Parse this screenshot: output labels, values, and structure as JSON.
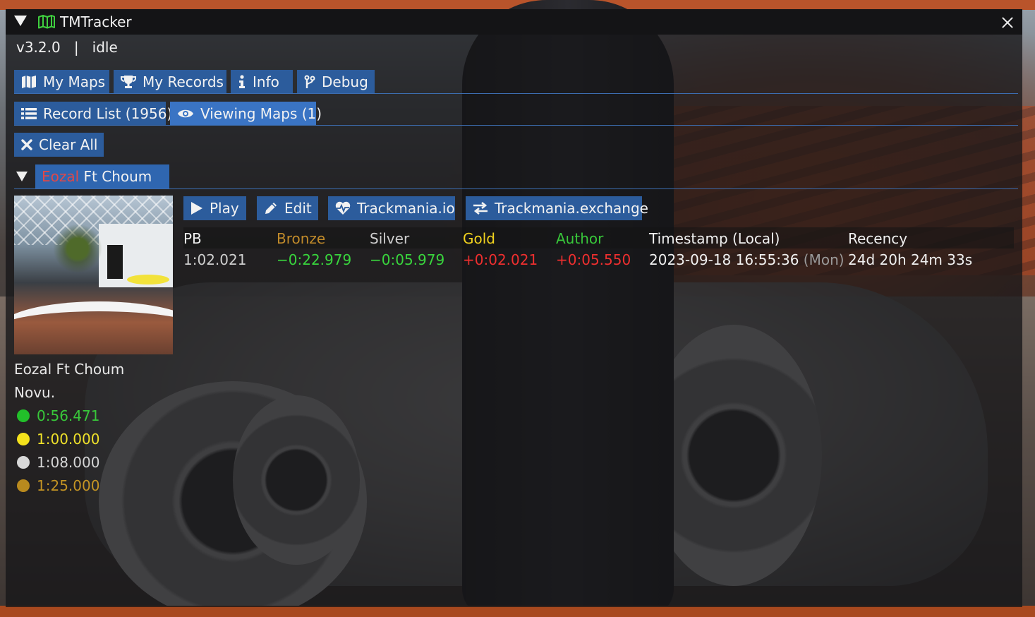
{
  "window": {
    "title": "TMTracker",
    "version": "v3.2.0",
    "separator": "|",
    "state": "idle"
  },
  "tabs": [
    {
      "label": "My Maps",
      "icon": "map-icon"
    },
    {
      "label": "My Records",
      "icon": "trophy-icon"
    },
    {
      "label": "Info",
      "icon": "info-icon"
    },
    {
      "label": "Debug",
      "icon": "code-branch-icon"
    }
  ],
  "subtabs": [
    {
      "label": "Record List (1956)",
      "icon": "list-icon"
    },
    {
      "label": "Viewing Maps (1)",
      "icon": "eye-icon"
    }
  ],
  "clear_all": {
    "label": "Clear All",
    "icon": "x-icon"
  },
  "map": {
    "tab_name_red": "Eozal",
    "tab_name_rest": " Ft Choum",
    "name": "Eozal Ft Choum",
    "author": "Novu.",
    "actions": [
      {
        "label": "Play",
        "icon": "play-icon"
      },
      {
        "label": "Edit",
        "icon": "pencil-icon"
      },
      {
        "label": "Trackmania.io",
        "icon": "heartbeat-icon"
      },
      {
        "label": "Trackmania.exchange",
        "icon": "exchange-icon"
      }
    ],
    "medals": [
      {
        "time": "0:56.471",
        "color": "#22c02a",
        "text_color": "#38c73a",
        "name": "author-medal"
      },
      {
        "time": "1:00.000",
        "color": "#f4e21c",
        "text_color": "#efe12a",
        "name": "gold-medal"
      },
      {
        "time": "1:08.000",
        "color": "#d8d8d8",
        "text_color": "#d6d6d6",
        "name": "silver-medal"
      },
      {
        "time": "1:25.000",
        "color": "#b98a1e",
        "text_color": "#c49424",
        "name": "bronze-medal"
      }
    ],
    "table": {
      "headers": [
        "PB",
        "Bronze",
        "Silver",
        "Gold",
        "Author",
        "Timestamp (Local)",
        "Recency"
      ],
      "header_colors": [
        "#f0f0f0",
        "#c08a2a",
        "#cfcfcf",
        "#f1d21e",
        "#38c73a",
        "#f0f0f0",
        "#f0f0f0"
      ],
      "row": {
        "pb": "1:02.021",
        "bronze": "−0:22.979",
        "silver": "−0:05.979",
        "gold": "+0:02.021",
        "author": "+0:05.550",
        "timestamp": "2023-09-18 16:55:36",
        "weekday": "(Mon)",
        "recency": "24d 20h 24m 33s"
      },
      "row_colors": {
        "ahead": "#39d53d",
        "behind": "#ef2f2f",
        "pb": "#cfcfcf"
      }
    }
  },
  "colors": {
    "button": "#2c5c9c",
    "button_active": "#3a74c4",
    "separator": "#3c6db0"
  }
}
